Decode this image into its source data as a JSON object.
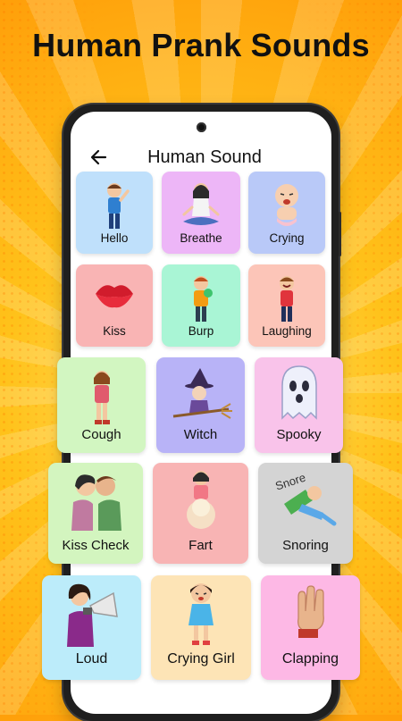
{
  "promo": {
    "headline": "Human Prank Sounds"
  },
  "screen": {
    "title": "Human Sound",
    "back_icon": "arrow-left-icon"
  },
  "colors": {
    "hello": "#bfe0fb",
    "breathe": "#edb6f7",
    "crying": "#b9c9f8",
    "kiss": "#f9b4b4",
    "burp": "#a9f5d5",
    "laughing": "#fcc5b8",
    "cough": "#d2f6c1",
    "witch": "#b8b3f7",
    "spooky": "#f9c3ea",
    "kiss_check": "#d3f5bf",
    "fart": "#f8b4b4",
    "snoring": "#d4d4d4",
    "loud": "#bcecfa",
    "crying_girl": "#fde4b6",
    "clapping": "#fdb8e5"
  },
  "sounds": [
    {
      "label": "Hello",
      "icon": "boy-waving-icon"
    },
    {
      "label": "Breathe",
      "icon": "meditating-woman-icon"
    },
    {
      "label": "Crying",
      "icon": "crying-baby-icon"
    },
    {
      "label": "Kiss",
      "icon": "lips-icon"
    },
    {
      "label": "Burp",
      "icon": "burping-boy-icon"
    },
    {
      "label": "Laughing",
      "icon": "laughing-boy-icon"
    },
    {
      "label": "Cough",
      "icon": "coughing-girl-icon"
    },
    {
      "label": "Witch",
      "icon": "witch-icon"
    },
    {
      "label": "Spooky",
      "icon": "ghost-icon"
    },
    {
      "label": "Kiss Check",
      "icon": "kissing-couple-icon"
    },
    {
      "label": "Fart",
      "icon": "farting-girl-icon"
    },
    {
      "label": "Snoring",
      "icon": "sleeping-boy-icon"
    },
    {
      "label": "Loud",
      "icon": "megaphone-woman-icon"
    },
    {
      "label": "Crying Girl",
      "icon": "crying-girl-icon"
    },
    {
      "label": "Clapping",
      "icon": "clapping-hands-icon"
    }
  ],
  "snore_text": "Snore"
}
